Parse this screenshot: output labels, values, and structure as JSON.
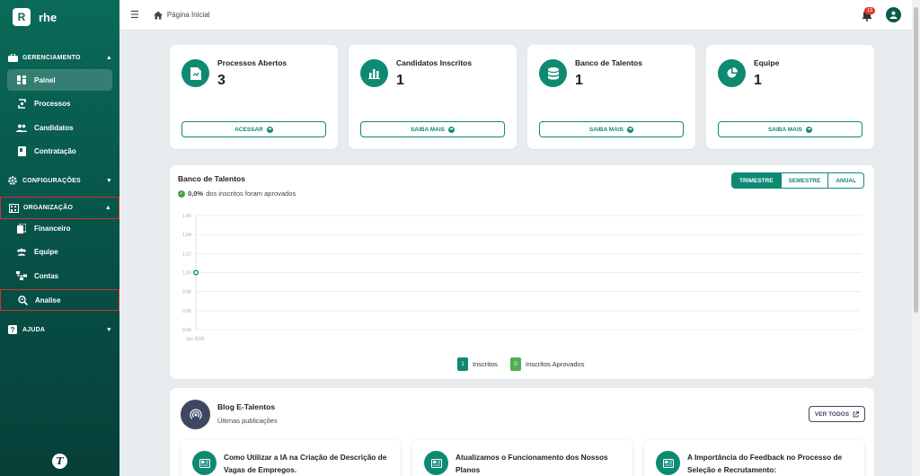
{
  "brand": {
    "logo_letter": "R",
    "name": "rhe"
  },
  "sidebar": {
    "sections": [
      {
        "label": "GERENCIAMENTO",
        "icon": "briefcase-icon",
        "chevron": "▲"
      },
      {
        "label": "CONFIGURAÇÕES",
        "icon": "gear-icon",
        "chevron": "▼"
      },
      {
        "label": "ORGANIZAÇÃO",
        "icon": "building-icon",
        "chevron": "▲"
      },
      {
        "label": "AJUDA",
        "icon": "help-icon",
        "chevron": "▼"
      }
    ],
    "items": [
      {
        "label": "Painel",
        "icon": "dashboard-icon"
      },
      {
        "label": "Processos",
        "icon": "process-icon"
      },
      {
        "label": "Candidatos",
        "icon": "users-icon"
      },
      {
        "label": "Contratação",
        "icon": "contract-icon"
      },
      {
        "label": "Financeiro",
        "icon": "finance-icon"
      },
      {
        "label": "Equipe",
        "icon": "team-icon"
      },
      {
        "label": "Contas",
        "icon": "accounts-icon"
      },
      {
        "label": "Analise",
        "icon": "analysis-icon"
      }
    ],
    "footer_logo": "T"
  },
  "topbar": {
    "breadcrumb": "Página Inicial",
    "notification_count": "13"
  },
  "stats": [
    {
      "label": "Processos Abertos",
      "value": "3",
      "button": "ACESSAR",
      "icon": "document-icon"
    },
    {
      "label": "Candidatos Inscritos",
      "value": "1",
      "button": "SAIBA MAIS",
      "icon": "bar-chart-icon"
    },
    {
      "label": "Banco de Talentos",
      "value": "1",
      "button": "SAIBA MAIS",
      "icon": "database-icon"
    },
    {
      "label": "Equipe",
      "value": "1",
      "button": "SAIBA MAIS",
      "icon": "pie-chart-icon"
    }
  ],
  "talent_chart": {
    "title": "Banco de Talentos",
    "subtitle_value": "0,0%",
    "subtitle_text": "dos inscritos foram aprovados",
    "periods": [
      "TRIMESTRE",
      "SEMESTRE",
      "ANUAL"
    ],
    "active_period": "TRIMESTRE",
    "legend": [
      {
        "count": "1",
        "label": "Inscritos",
        "color": "#0e8a73"
      },
      {
        "count": "0",
        "label": "Inscritos Aprovados",
        "color": "#4caf50"
      }
    ]
  },
  "chart_data": {
    "type": "line",
    "x": [
      "Jun 2025"
    ],
    "series": [
      {
        "values": [
          1.0
        ]
      }
    ],
    "yticks": [
      "1,06",
      "1,04",
      "1,02",
      "1,00",
      "0,98",
      "0,96",
      "0,94"
    ],
    "ylim": [
      0.94,
      1.06
    ],
    "grid": true
  },
  "blog": {
    "title": "Blog E-Talentos",
    "subtitle": "Últimas publicações",
    "view_all": "VER TODOS",
    "posts": [
      {
        "title": "Como Utilizar a IA na Criação de Descrição de Vagas de Empregos."
      },
      {
        "title": "Atualizamos o Funcionamento dos Nossos Planos"
      },
      {
        "title": "A Importância do Feedback no Processo de Seleção e Recrutamento:"
      }
    ]
  }
}
